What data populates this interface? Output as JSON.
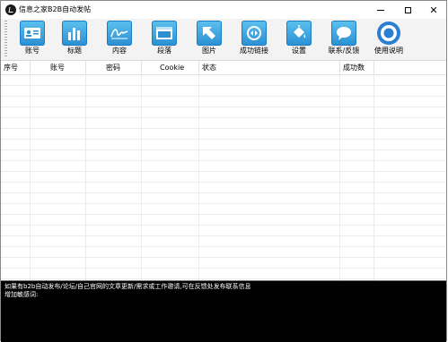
{
  "window": {
    "title": "信息之家B2B自动发帖",
    "minimize_glyph": "",
    "maximize_glyph": "",
    "close_glyph": "✕"
  },
  "toolbar": {
    "items": [
      {
        "label": "账号",
        "icon": "account-card-icon"
      },
      {
        "label": "标题",
        "icon": "bar-chart-icon"
      },
      {
        "label": "内容",
        "icon": "signature-icon"
      },
      {
        "label": "段落",
        "icon": "browser-window-icon"
      },
      {
        "label": "图片",
        "icon": "arrow-up-left-icon"
      },
      {
        "label": "成功链接",
        "icon": "loop-link-icon"
      },
      {
        "label": "设置",
        "icon": "paint-bucket-icon"
      },
      {
        "label": "联系/反馈",
        "icon": "speech-bubble-icon"
      },
      {
        "label": "使用说明",
        "icon": "chrome-icon"
      }
    ]
  },
  "grid": {
    "columns": [
      "序号",
      "账号",
      "密码",
      "Cookie",
      "状态",
      "成功数"
    ]
  },
  "console": {
    "lines": [
      "如果有b2b自动发布/论坛/自己官网的文章更新/需求或工作邀请,可在反馈处发布联系信息",
      "增加敏感词:"
    ]
  },
  "colors": {
    "icon_blue": "#2a8fd3",
    "console_bg": "#000000",
    "console_text": "#ffffff"
  }
}
